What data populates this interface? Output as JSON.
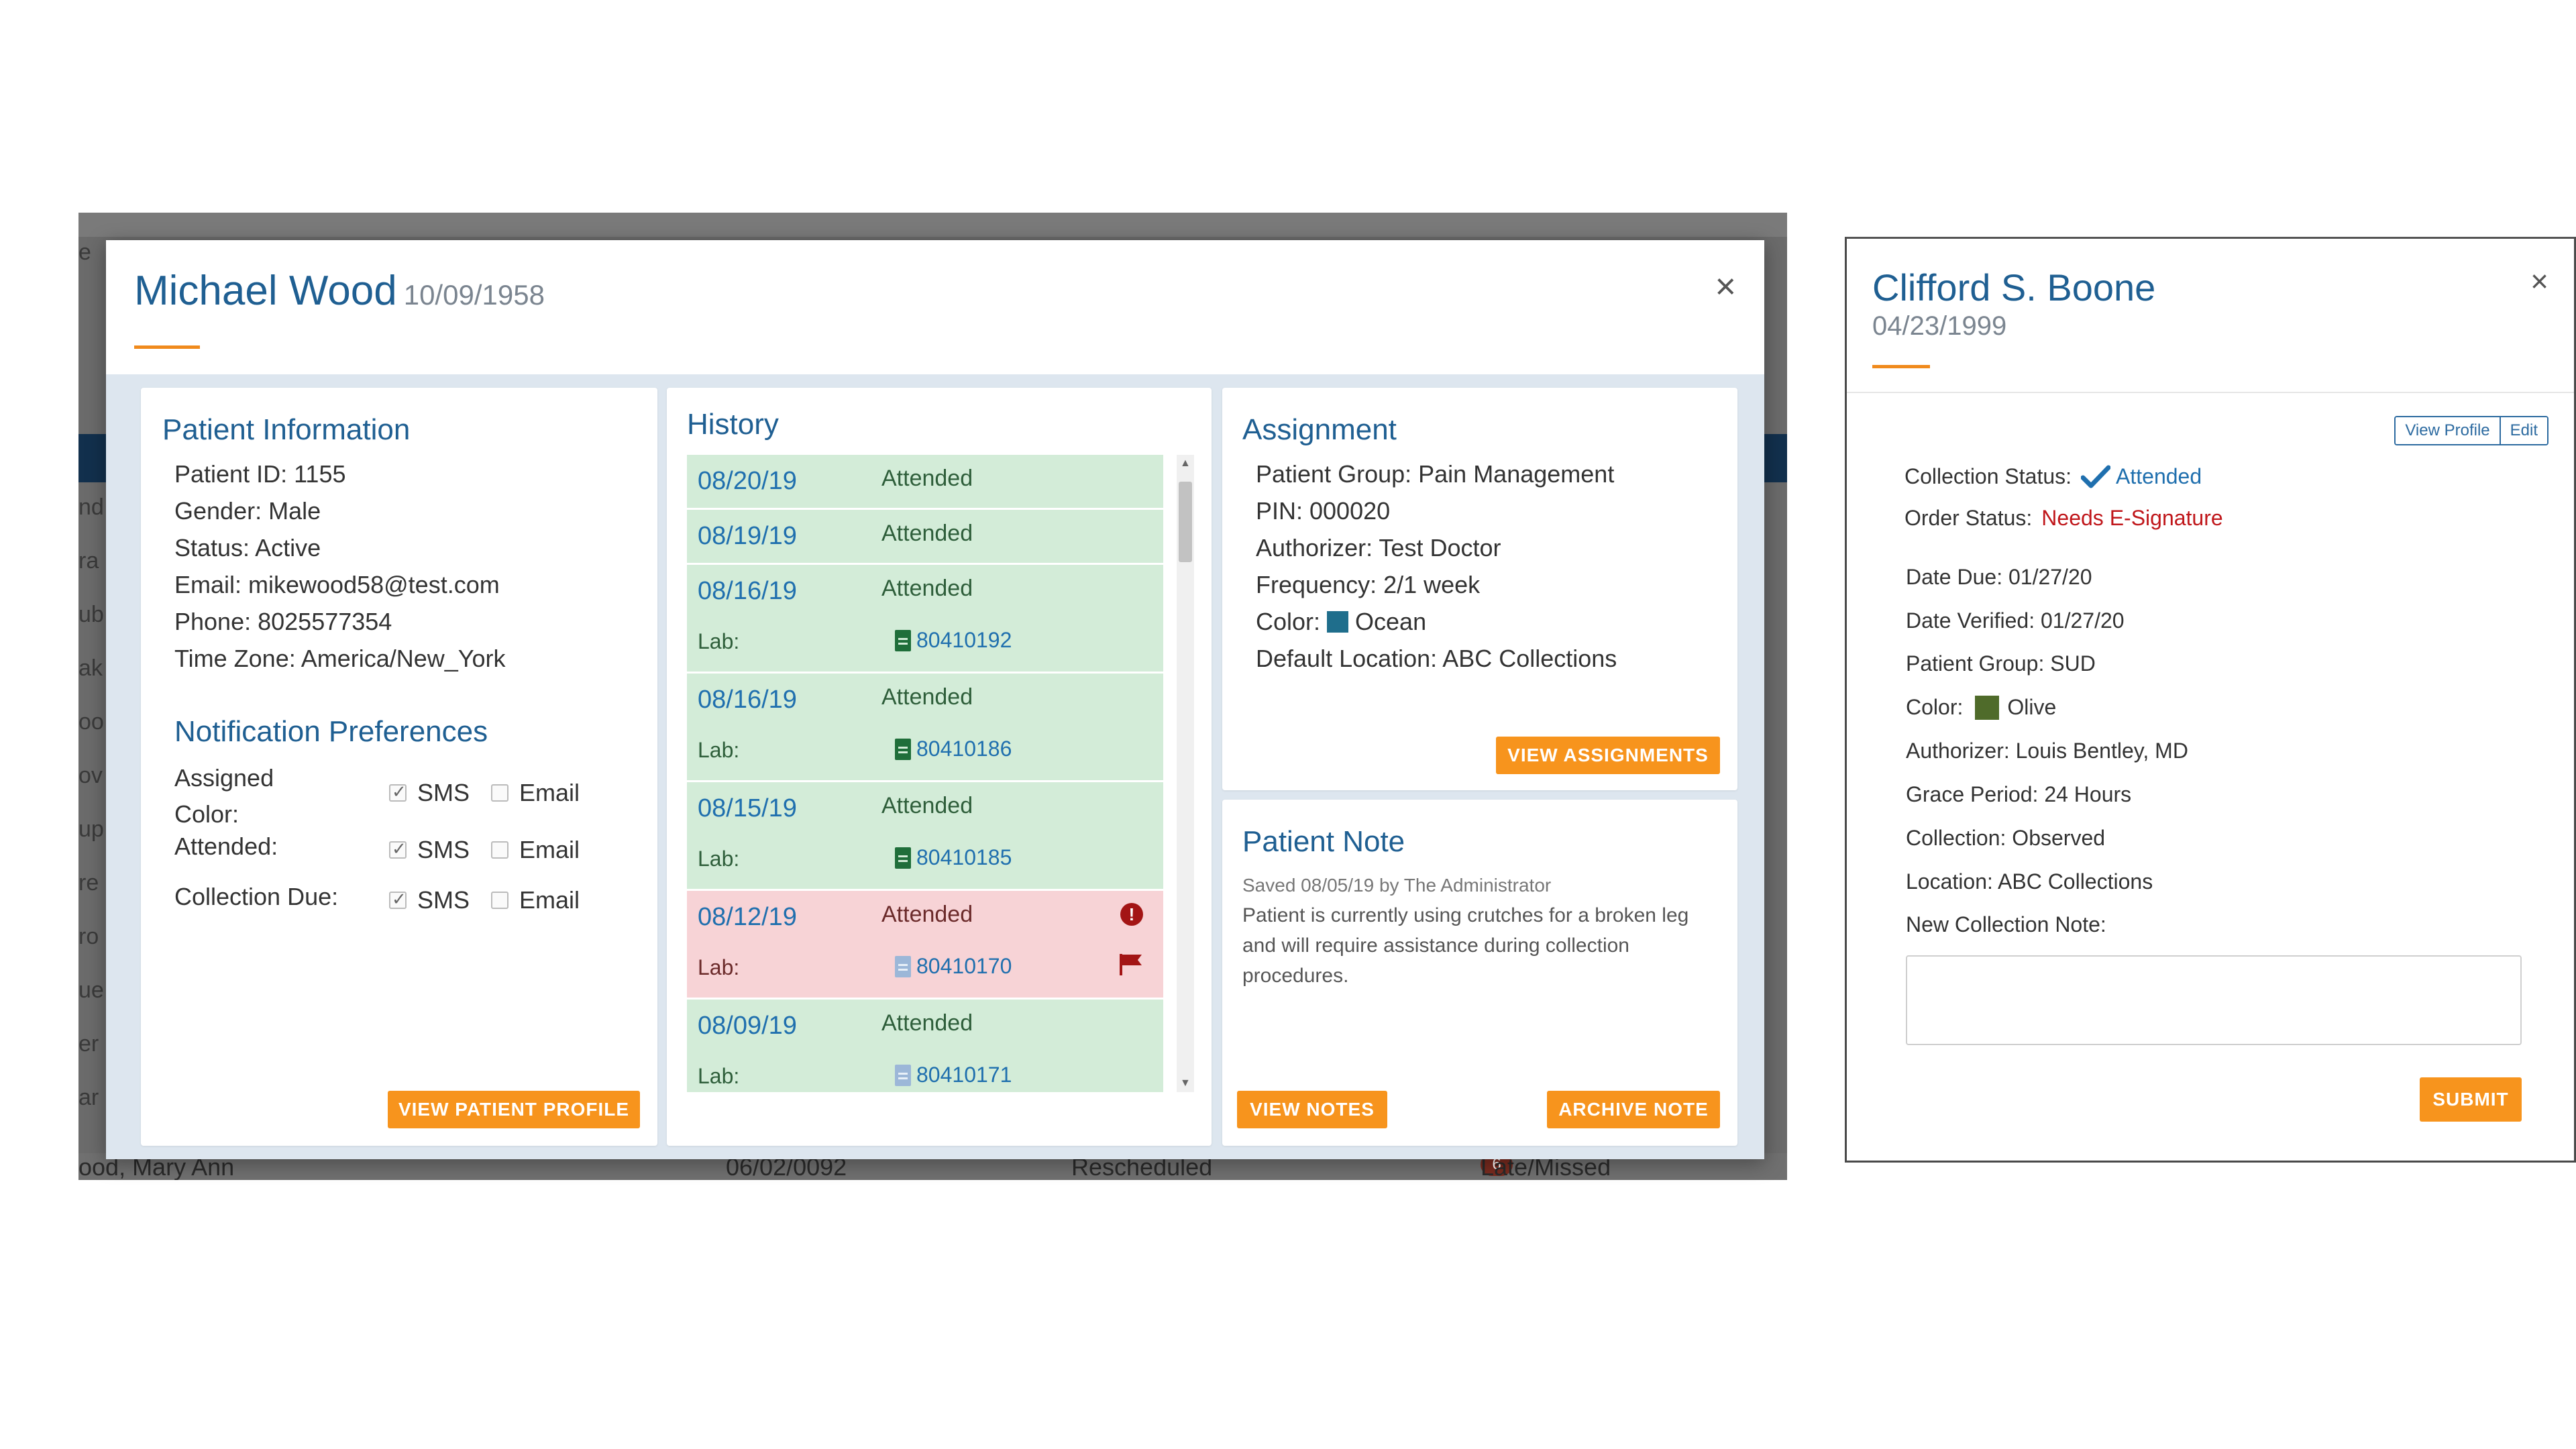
{
  "left_modal": {
    "name": "Michael Wood",
    "dob": "10/09/1958",
    "close_label": "×",
    "background": {
      "bottom_row": {
        "name": "ood, Mary Ann",
        "date": "06/02/0092",
        "status": "Rescheduled",
        "badge_count": "6",
        "badge_label": "Late/Missed"
      }
    },
    "patient_info": {
      "title": "Patient Information",
      "lines": [
        "Patient ID: 1155",
        "Gender: Male",
        "Status: Active",
        "Email: mikewood58@test.com",
        "Phone: 8025577354",
        "Time Zone: America/New_York"
      ],
      "notif_title": "Notification Preferences",
      "prefs": [
        {
          "label": "Assigned Color:",
          "sms": "SMS",
          "email": "Email"
        },
        {
          "label": "Attended:",
          "sms": "SMS",
          "email": "Email"
        },
        {
          "label": "Collection Due:",
          "sms": "SMS",
          "email": "Email"
        }
      ],
      "button": "VIEW PATIENT PROFILE"
    },
    "history": {
      "title": "History",
      "lab_label": "Lab:",
      "items": [
        {
          "date": "08/20/19",
          "status": "Attended",
          "lab": ""
        },
        {
          "date": "08/19/19",
          "status": "Attended",
          "lab": ""
        },
        {
          "date": "08/16/19",
          "status": "Attended",
          "lab": "80410192"
        },
        {
          "date": "08/16/19",
          "status": "Attended",
          "lab": "80410186"
        },
        {
          "date": "08/15/19",
          "status": "Attended",
          "lab": "80410185"
        },
        {
          "date": "08/12/19",
          "status": "Attended",
          "lab": "80410170"
        },
        {
          "date": "08/09/19",
          "status": "Attended",
          "lab": "80410171"
        }
      ]
    },
    "assignment": {
      "title": "Assignment",
      "lines": [
        "Patient Group: Pain Management",
        "PIN: 000020",
        "Authorizer: Test Doctor"
      ],
      "frequency": "Frequency: 2/1 week",
      "color_label": "Color:",
      "color_name": "Ocean",
      "color_hex": "#1f6e8c",
      "default_location": "Default Location: ABC Collections",
      "button": "VIEW ASSIGNMENTS"
    },
    "patient_note": {
      "title": "Patient Note",
      "meta": "Saved 08/05/19 by The Administrator",
      "text": "Patient is currently using crutches for a broken leg and will require assistance during collection procedures.",
      "view_button": "VIEW NOTES",
      "archive_button": "ARCHIVE NOTE"
    }
  },
  "right_panel": {
    "name": "Clifford S. Boone",
    "dob": "04/23/1999",
    "close_label": "×",
    "view_profile": "View Profile",
    "edit": "Edit",
    "collection_status_label": "Collection Status:",
    "collection_status_value": "Attended",
    "order_status_label": "Order Status:",
    "order_status_value": "Needs E-Signature",
    "date_due": "Date Due: 01/27/20",
    "date_verified": "Date Verified: 01/27/20",
    "patient_group": "Patient Group: SUD",
    "color_label": "Color:",
    "color_name": "Olive",
    "color_hex": "#4f6b2a",
    "authorizer": "Authorizer: Louis Bentley, MD",
    "grace_period": "Grace Period: 24 Hours",
    "collection": "Collection: Observed",
    "location": "Location: ABC Collections",
    "new_note_label": "New Collection Note:",
    "new_note_value": "",
    "submit": "SUBMIT"
  }
}
